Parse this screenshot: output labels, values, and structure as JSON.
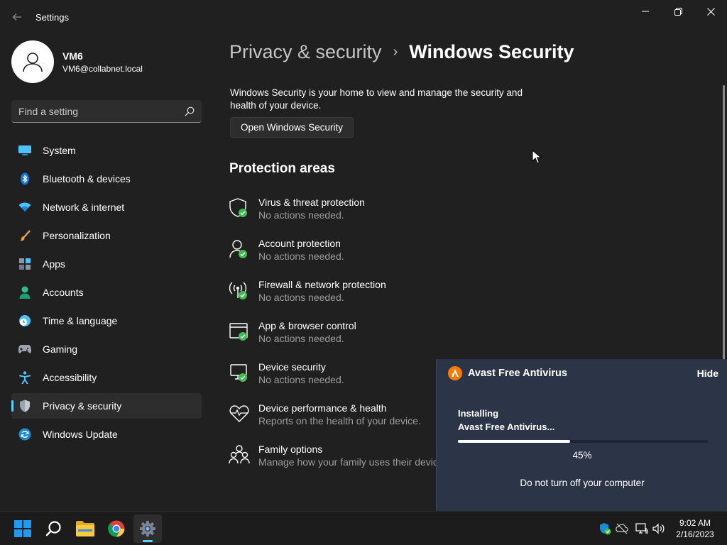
{
  "window": {
    "title": "Settings",
    "back_icon": "arrow-left-icon",
    "minimize_icon": "minimize-icon",
    "maximize_icon": "restore-icon",
    "close_icon": "close-icon"
  },
  "profile": {
    "name": "VM6",
    "email": "VM6@collabnet.local"
  },
  "search": {
    "placeholder": "Find a setting",
    "icon": "search-icon"
  },
  "nav": {
    "items": [
      {
        "label": "System",
        "icon": "system-icon",
        "active": false
      },
      {
        "label": "Bluetooth & devices",
        "icon": "bluetooth-icon",
        "active": false
      },
      {
        "label": "Network & internet",
        "icon": "wifi-icon",
        "active": false
      },
      {
        "label": "Personalization",
        "icon": "brush-icon",
        "active": false
      },
      {
        "label": "Apps",
        "icon": "apps-icon",
        "active": false
      },
      {
        "label": "Accounts",
        "icon": "accounts-icon",
        "active": false
      },
      {
        "label": "Time & language",
        "icon": "clock-globe-icon",
        "active": false
      },
      {
        "label": "Gaming",
        "icon": "gamepad-icon",
        "active": false
      },
      {
        "label": "Accessibility",
        "icon": "accessibility-icon",
        "active": false
      },
      {
        "label": "Privacy & security",
        "icon": "shield-icon",
        "active": true
      },
      {
        "label": "Windows Update",
        "icon": "update-icon",
        "active": false
      }
    ]
  },
  "breadcrumb": {
    "parent": "Privacy & security",
    "separator": "›",
    "current": "Windows Security"
  },
  "main": {
    "description": "Windows Security is your home to view and manage the security and health of your device.",
    "open_button": "Open Windows Security",
    "section_title": "Protection areas",
    "areas": [
      {
        "title": "Virus & threat protection",
        "status": "No actions needed.",
        "icon": "virus-shield-icon"
      },
      {
        "title": "Account protection",
        "status": "No actions needed.",
        "icon": "account-protection-icon"
      },
      {
        "title": "Firewall & network protection",
        "status": "No actions needed.",
        "icon": "firewall-icon"
      },
      {
        "title": "App & browser control",
        "status": "No actions needed.",
        "icon": "app-browser-icon"
      },
      {
        "title": "Device security",
        "status": "No actions needed.",
        "icon": "device-security-icon"
      },
      {
        "title": "Device performance & health",
        "status": "Reports on the health of your device.",
        "icon": "heart-icon"
      },
      {
        "title": "Family options",
        "status": "Manage how your family uses their devic",
        "icon": "family-icon"
      }
    ]
  },
  "popup": {
    "title": "Avast Free Antivirus",
    "hide_label": "Hide",
    "status_line1": "Installing",
    "status_line2": "Avast Free Antivirus...",
    "progress_fraction": 0.45,
    "progress_text": "45%",
    "note": "Do not turn off your computer",
    "accent_color": "#ff7800"
  },
  "taskbar": {
    "apps": [
      {
        "name": "Start",
        "icon": "windows-logo-icon"
      },
      {
        "name": "Search",
        "icon": "search-icon"
      },
      {
        "name": "File Explorer",
        "icon": "folder-icon"
      },
      {
        "name": "Chrome",
        "icon": "chrome-icon"
      },
      {
        "name": "Settings",
        "icon": "gear-icon",
        "active": true
      }
    ],
    "tray": [
      "defender-icon",
      "network-off-icon",
      "monitor-icon",
      "volume-icon"
    ],
    "time": "9:02 AM",
    "date": "2/16/2023"
  },
  "colors": {
    "accent": "#60cdff",
    "background": "#202020",
    "check": "#3fbb4f"
  }
}
